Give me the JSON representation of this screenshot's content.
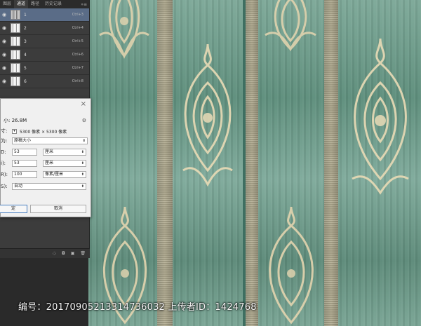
{
  "panel": {
    "tabs": [
      "图层",
      "通道",
      "路径",
      "历史记录"
    ],
    "active_tab_index": 1,
    "menu_label": "»≡",
    "layers": [
      {
        "name": "1",
        "shortcut": "Ctrl+3",
        "selected": true
      },
      {
        "name": "2",
        "shortcut": "Ctrl+4",
        "selected": false
      },
      {
        "name": "3",
        "shortcut": "Ctrl+5",
        "selected": false
      },
      {
        "name": "4",
        "shortcut": "Ctrl+6",
        "selected": false
      },
      {
        "name": "5",
        "shortcut": "Ctrl+7",
        "selected": false
      },
      {
        "name": "6",
        "shortcut": "Ctrl+8",
        "selected": false
      }
    ],
    "footer_icons": [
      "selection-icon",
      "mask-icon",
      "new-layer-icon",
      "delete-icon"
    ]
  },
  "dialog": {
    "size_label": "小: 26.8M",
    "dimension_label": "寸:",
    "dimension_value": "5300 像素 × 5300 像素",
    "fit_label": "为:",
    "fit_value": "原稿大小",
    "width_label": "D:",
    "width_value": "53",
    "width_unit": "厘米",
    "height_label": "i):",
    "height_value": "53",
    "height_unit": "厘米",
    "res_label": "R):",
    "res_value": "100",
    "res_unit": "像素/厘米",
    "resample_label": "S):",
    "resample_value": "自动",
    "ok_label": "定",
    "cancel_label": "取消",
    "close_glyph": "×"
  },
  "watermark": {
    "text": "编号：20170905213314736032 上传者ID：1424768"
  },
  "colors": {
    "stripe_green": "#6f9a8b",
    "stripe_gold": "#b0aa8e",
    "selected_layer": "#5a6c87",
    "panel_bg": "#3c3c3c"
  }
}
